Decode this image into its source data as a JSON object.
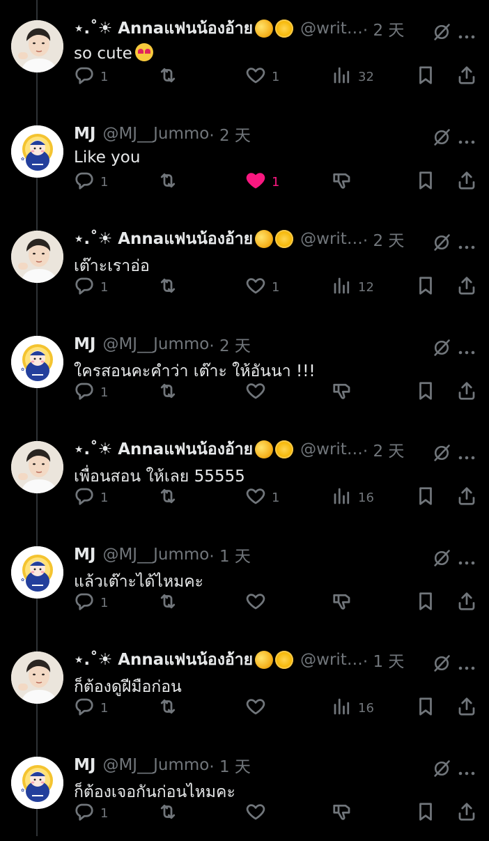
{
  "colors": {
    "background": "#000000",
    "text": "#e7e9ea",
    "muted": "#71767b",
    "like_active": "#f91880"
  },
  "tweets": [
    {
      "avatar": "photo",
      "name": "⋆.˚☀︎ Annaแฟนน้องอ้าย",
      "emojis": [
        "dizzy",
        "sun"
      ],
      "handle": "@writ…",
      "time": "· 2 天",
      "text": "so cute",
      "has_emoji": true,
      "reply_count": "1",
      "like_count": "1",
      "liked": false,
      "second_action": "views",
      "views": "32"
    },
    {
      "avatar": "cartoon",
      "name": "MJ",
      "emojis": [],
      "handle": "@MJ__Jummo",
      "time": "· 2 天",
      "text": "Like you",
      "has_emoji": false,
      "reply_count": "1",
      "like_count": "1",
      "liked": true,
      "second_action": "downvote",
      "views": ""
    },
    {
      "avatar": "photo",
      "name": "⋆.˚☀︎ Annaแฟนน้องอ้าย",
      "emojis": [
        "dizzy",
        "sun"
      ],
      "handle": "@writ…",
      "time": "· 2 天",
      "text": "เต๊าะเราอ่อ",
      "has_emoji": false,
      "reply_count": "1",
      "like_count": "1",
      "liked": false,
      "second_action": "views",
      "views": "12"
    },
    {
      "avatar": "cartoon",
      "name": "MJ",
      "emojis": [],
      "handle": "@MJ__Jummo",
      "time": "· 2 天",
      "text": "ใครสอนคะคำว่า เต๊าะ ให้อันนา !!!",
      "has_emoji": false,
      "reply_count": "1",
      "like_count": "",
      "liked": false,
      "second_action": "downvote",
      "views": ""
    },
    {
      "avatar": "photo",
      "name": "⋆.˚☀︎ Annaแฟนน้องอ้าย",
      "emojis": [
        "dizzy",
        "sun"
      ],
      "handle": "@writ…",
      "time": "· 2 天",
      "text": "เพื่อนสอน ให้เลย 55555",
      "has_emoji": false,
      "reply_count": "1",
      "like_count": "1",
      "liked": false,
      "second_action": "views",
      "views": "16"
    },
    {
      "avatar": "cartoon",
      "name": "MJ",
      "emojis": [],
      "handle": "@MJ__Jummo",
      "time": "· 1 天",
      "text": "แล้วเต๊าะได้ไหมคะ",
      "has_emoji": false,
      "reply_count": "1",
      "like_count": "",
      "liked": false,
      "second_action": "downvote",
      "views": ""
    },
    {
      "avatar": "photo",
      "name": "⋆.˚☀︎ Annaแฟนน้องอ้าย",
      "emojis": [
        "dizzy",
        "sun"
      ],
      "handle": "@writ…",
      "time": "· 1 天",
      "text": "ก็ต้องดูฝีมือก่อน",
      "has_emoji": false,
      "reply_count": "1",
      "like_count": "",
      "liked": false,
      "second_action": "views",
      "views": "16"
    },
    {
      "avatar": "cartoon",
      "name": "MJ",
      "emojis": [],
      "handle": "@MJ__Jummo",
      "time": "· 1 天",
      "text": "ก็ต้องเจอกันก่อนไหมคะ",
      "has_emoji": false,
      "reply_count": "1",
      "like_count": "",
      "liked": false,
      "second_action": "downvote",
      "views": ""
    }
  ],
  "icons": {
    "reply": "reply-icon",
    "retweet": "retweet-icon",
    "like": "heart-icon",
    "views": "views-chart-icon",
    "downvote": "downvote-icon",
    "bookmark": "bookmark-icon",
    "share": "share-icon",
    "grok": "grok-icon",
    "more": "more-icon"
  }
}
